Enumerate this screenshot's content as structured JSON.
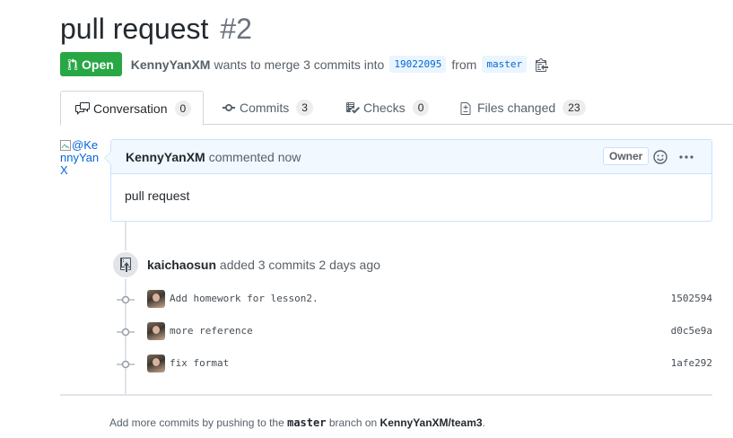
{
  "pr": {
    "title": "pull request",
    "number": "#2",
    "state": "Open",
    "author": "KennyYanXM",
    "merge_text_1": "wants to merge 3 commits into",
    "base_branch": "19022095",
    "merge_text_2": "from",
    "head_branch": "master"
  },
  "tabs": [
    {
      "label": "Conversation",
      "count": "0"
    },
    {
      "label": "Commits",
      "count": "3"
    },
    {
      "label": "Checks",
      "count": "0"
    },
    {
      "label": "Files changed",
      "count": "23"
    }
  ],
  "comment": {
    "avatar_alt": "@KennyYanX",
    "author": "KennyYanXM",
    "meta": "commented now",
    "badge": "Owner",
    "body": "pull request"
  },
  "event": {
    "actor": "kaichaosun",
    "text": "added 3 commits 2 days ago"
  },
  "commits": [
    {
      "message": "Add homework for lesson2.",
      "sha": "1502594"
    },
    {
      "message": "more reference",
      "sha": "d0c5e9a"
    },
    {
      "message": "fix format",
      "sha": "1afe292"
    }
  ],
  "footer": {
    "prefix": "Add more commits by pushing to the",
    "branch": "master",
    "middle": "branch on",
    "repo": "KennyYanXM/team3",
    "suffix": "."
  },
  "colors": {
    "open_state": "#28a745",
    "link": "#0366d6",
    "comment_header": "#f1f8ff"
  }
}
